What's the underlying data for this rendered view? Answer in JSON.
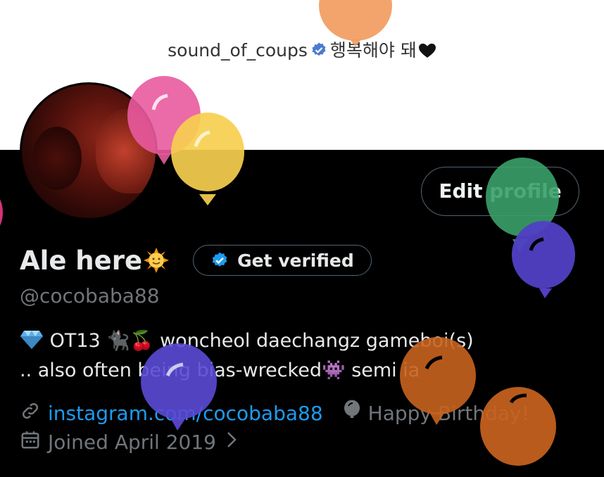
{
  "banner": {
    "username": "sound_of_coups",
    "korean_text": "행복해야 돼",
    "heart_emoji": "🖤"
  },
  "profile": {
    "edit_button_label": "Edit profile",
    "display_name": "Ale here",
    "name_emoji": "🌞",
    "get_verified_label": "Get verified",
    "handle": "@cocobaba88",
    "bio_line1_prefix": "💎",
    "bio_line1": "OT13 🐈‍⬛🍒 woncheol daechangz gameboi(s)",
    "bio_line2_a": ".. also often being bias-wrecked",
    "bio_line2_emoji": "👾",
    "bio_line2_b": "semi ia",
    "website": "instagram.com/cocobaba88",
    "birthday": "Happy Birthday!",
    "joined": "Joined April 2019"
  },
  "colors": {
    "background": "#000000",
    "banner": "#ffffff",
    "link": "#1d9bf0",
    "verified": "#1d9bf0",
    "muted": "#71767b"
  },
  "icons": [
    "verified-badge-icon",
    "link-icon",
    "balloon-icon",
    "calendar-icon",
    "chevron-right-icon"
  ]
}
